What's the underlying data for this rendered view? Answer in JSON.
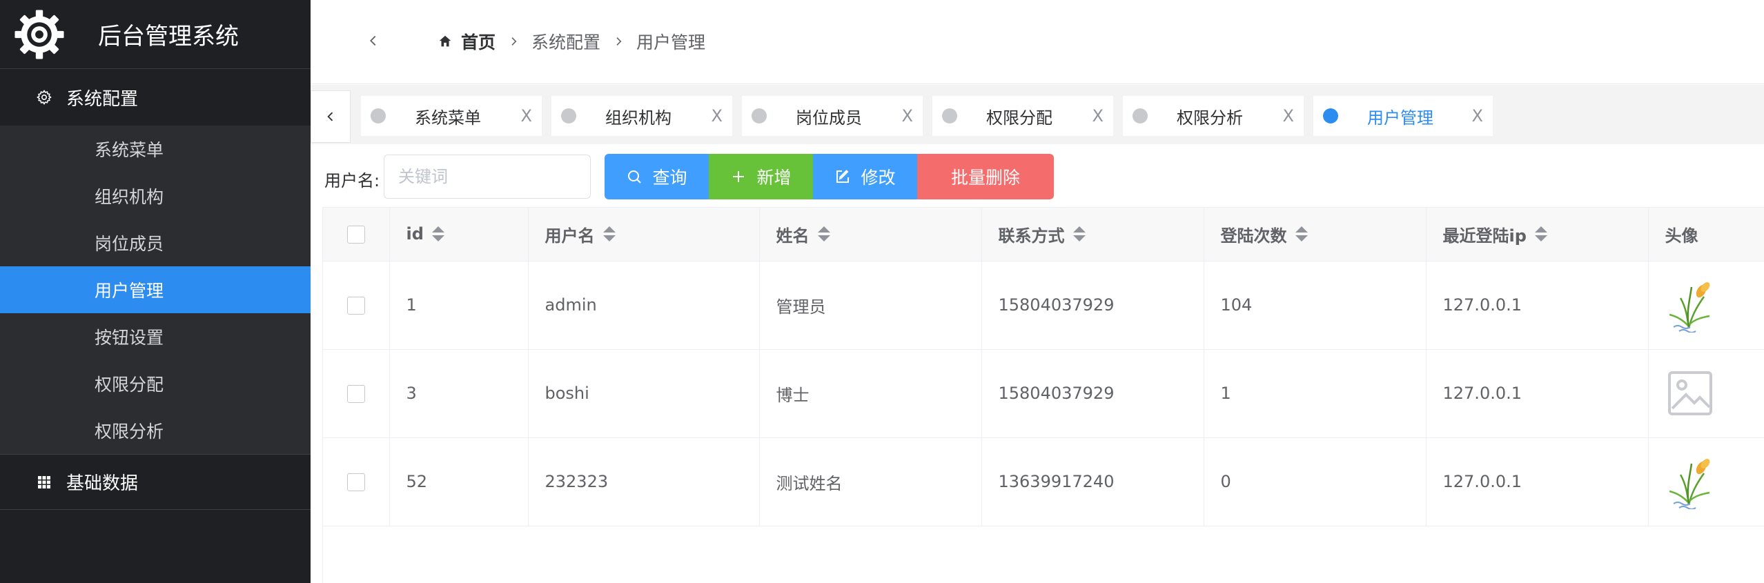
{
  "app": {
    "title": "后台管理系统"
  },
  "sidebar": {
    "group1": {
      "label": "系统配置",
      "icon": "gear-icon"
    },
    "items": [
      {
        "label": "系统菜单",
        "active": false
      },
      {
        "label": "组织机构",
        "active": false
      },
      {
        "label": "岗位成员",
        "active": false
      },
      {
        "label": "用户管理",
        "active": true
      },
      {
        "label": "按钮设置",
        "active": false
      },
      {
        "label": "权限分配",
        "active": false
      },
      {
        "label": "权限分析",
        "active": false
      }
    ],
    "group2": {
      "label": "基础数据",
      "icon": "grid-icon"
    }
  },
  "breadcrumb": {
    "home": "首页",
    "level1": "系统配置",
    "level2": "用户管理"
  },
  "tabs": [
    {
      "label": "系统菜单",
      "close": "X",
      "active": false
    },
    {
      "label": "组织机构",
      "close": "X",
      "active": false
    },
    {
      "label": "岗位成员",
      "close": "X",
      "active": false
    },
    {
      "label": "权限分配",
      "close": "X",
      "active": false
    },
    {
      "label": "权限分析",
      "close": "X",
      "active": false
    },
    {
      "label": "用户管理",
      "close": "X",
      "active": true
    }
  ],
  "toolbar": {
    "filter_label": "用户名:",
    "search_placeholder": "关键词",
    "search_value": "",
    "query_label": "查询",
    "add_label": "新增",
    "edit_label": "修改",
    "delete_label": "批量删除"
  },
  "table": {
    "headers": [
      "id",
      "用户名",
      "姓名",
      "联系方式",
      "登陆次数",
      "最近登陆ip",
      "头像"
    ],
    "rows": [
      {
        "id": "1",
        "username": "admin",
        "name": "管理员",
        "phone": "15804037929",
        "logins": "104",
        "ip": "127.0.0.1",
        "avatar": "flower-avatar-icon"
      },
      {
        "id": "3",
        "username": "boshi",
        "name": "博士",
        "phone": "15804037929",
        "logins": "1",
        "ip": "127.0.0.1",
        "avatar": "image-placeholder-icon"
      },
      {
        "id": "52",
        "username": "232323",
        "name": "测试姓名",
        "phone": "13639917240",
        "logins": "0",
        "ip": "127.0.0.1",
        "avatar": "flower-avatar-icon"
      }
    ]
  },
  "colors": {
    "sidebar_bg": "#1f2024",
    "submenu_bg": "#2b2d31",
    "active_blue": "#2d8cf0",
    "primary": "#409eff",
    "success": "#67c23a",
    "danger": "#f56c6c"
  }
}
